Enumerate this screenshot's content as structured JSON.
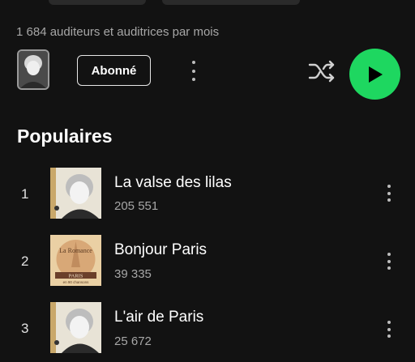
{
  "artist": {
    "monthly_listeners": "1 684 auditeurs et auditrices par mois",
    "follow_label": "Abonné"
  },
  "colors": {
    "background": "#121212",
    "accent": "#1ed760",
    "muted_text": "#a7a7a7"
  },
  "popular": {
    "title": "Populaires",
    "tracks": [
      {
        "rank": "1",
        "title": "La valse des lilas",
        "plays": "205 551",
        "cover": "portrait-photo"
      },
      {
        "rank": "2",
        "title": "Bonjour Paris",
        "plays": "39 335",
        "cover": "la-romance-paris-album"
      },
      {
        "rank": "3",
        "title": "L'air de Paris",
        "plays": "25 672",
        "cover": "portrait-photo"
      }
    ],
    "album_cover_text": {
      "top": "La Romance",
      "middle": "PARIS",
      "bottom": "en 90 chansons"
    }
  },
  "icons": [
    "more-vertical-icon",
    "shuffle-icon",
    "play-icon"
  ]
}
